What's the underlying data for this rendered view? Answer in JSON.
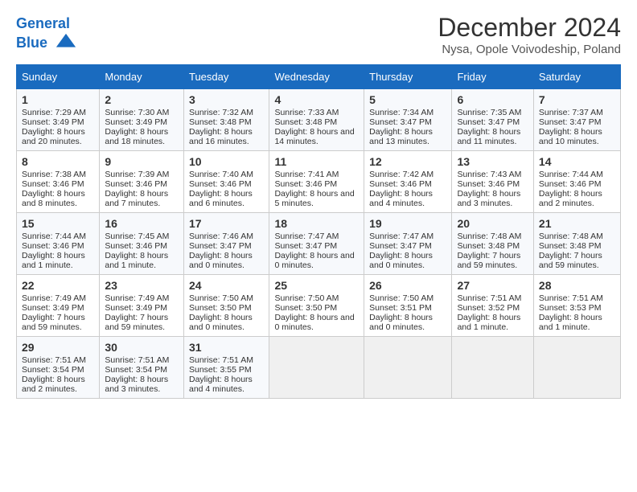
{
  "logo": {
    "line1": "General",
    "line2": "Blue"
  },
  "title": "December 2024",
  "subtitle": "Nysa, Opole Voivodeship, Poland",
  "headers": [
    "Sunday",
    "Monday",
    "Tuesday",
    "Wednesday",
    "Thursday",
    "Friday",
    "Saturday"
  ],
  "weeks": [
    [
      {
        "day": "1",
        "sunrise": "Sunrise: 7:29 AM",
        "sunset": "Sunset: 3:49 PM",
        "daylight": "Daylight: 8 hours and 20 minutes."
      },
      {
        "day": "2",
        "sunrise": "Sunrise: 7:30 AM",
        "sunset": "Sunset: 3:49 PM",
        "daylight": "Daylight: 8 hours and 18 minutes."
      },
      {
        "day": "3",
        "sunrise": "Sunrise: 7:32 AM",
        "sunset": "Sunset: 3:48 PM",
        "daylight": "Daylight: 8 hours and 16 minutes."
      },
      {
        "day": "4",
        "sunrise": "Sunrise: 7:33 AM",
        "sunset": "Sunset: 3:48 PM",
        "daylight": "Daylight: 8 hours and 14 minutes."
      },
      {
        "day": "5",
        "sunrise": "Sunrise: 7:34 AM",
        "sunset": "Sunset: 3:47 PM",
        "daylight": "Daylight: 8 hours and 13 minutes."
      },
      {
        "day": "6",
        "sunrise": "Sunrise: 7:35 AM",
        "sunset": "Sunset: 3:47 PM",
        "daylight": "Daylight: 8 hours and 11 minutes."
      },
      {
        "day": "7",
        "sunrise": "Sunrise: 7:37 AM",
        "sunset": "Sunset: 3:47 PM",
        "daylight": "Daylight: 8 hours and 10 minutes."
      }
    ],
    [
      {
        "day": "8",
        "sunrise": "Sunrise: 7:38 AM",
        "sunset": "Sunset: 3:46 PM",
        "daylight": "Daylight: 8 hours and 8 minutes."
      },
      {
        "day": "9",
        "sunrise": "Sunrise: 7:39 AM",
        "sunset": "Sunset: 3:46 PM",
        "daylight": "Daylight: 8 hours and 7 minutes."
      },
      {
        "day": "10",
        "sunrise": "Sunrise: 7:40 AM",
        "sunset": "Sunset: 3:46 PM",
        "daylight": "Daylight: 8 hours and 6 minutes."
      },
      {
        "day": "11",
        "sunrise": "Sunrise: 7:41 AM",
        "sunset": "Sunset: 3:46 PM",
        "daylight": "Daylight: 8 hours and 5 minutes."
      },
      {
        "day": "12",
        "sunrise": "Sunrise: 7:42 AM",
        "sunset": "Sunset: 3:46 PM",
        "daylight": "Daylight: 8 hours and 4 minutes."
      },
      {
        "day": "13",
        "sunrise": "Sunrise: 7:43 AM",
        "sunset": "Sunset: 3:46 PM",
        "daylight": "Daylight: 8 hours and 3 minutes."
      },
      {
        "day": "14",
        "sunrise": "Sunrise: 7:44 AM",
        "sunset": "Sunset: 3:46 PM",
        "daylight": "Daylight: 8 hours and 2 minutes."
      }
    ],
    [
      {
        "day": "15",
        "sunrise": "Sunrise: 7:44 AM",
        "sunset": "Sunset: 3:46 PM",
        "daylight": "Daylight: 8 hours and 1 minute."
      },
      {
        "day": "16",
        "sunrise": "Sunrise: 7:45 AM",
        "sunset": "Sunset: 3:46 PM",
        "daylight": "Daylight: 8 hours and 1 minute."
      },
      {
        "day": "17",
        "sunrise": "Sunrise: 7:46 AM",
        "sunset": "Sunset: 3:47 PM",
        "daylight": "Daylight: 8 hours and 0 minutes."
      },
      {
        "day": "18",
        "sunrise": "Sunrise: 7:47 AM",
        "sunset": "Sunset: 3:47 PM",
        "daylight": "Daylight: 8 hours and 0 minutes."
      },
      {
        "day": "19",
        "sunrise": "Sunrise: 7:47 AM",
        "sunset": "Sunset: 3:47 PM",
        "daylight": "Daylight: 8 hours and 0 minutes."
      },
      {
        "day": "20",
        "sunrise": "Sunrise: 7:48 AM",
        "sunset": "Sunset: 3:48 PM",
        "daylight": "Daylight: 7 hours and 59 minutes."
      },
      {
        "day": "21",
        "sunrise": "Sunrise: 7:48 AM",
        "sunset": "Sunset: 3:48 PM",
        "daylight": "Daylight: 7 hours and 59 minutes."
      }
    ],
    [
      {
        "day": "22",
        "sunrise": "Sunrise: 7:49 AM",
        "sunset": "Sunset: 3:49 PM",
        "daylight": "Daylight: 7 hours and 59 minutes."
      },
      {
        "day": "23",
        "sunrise": "Sunrise: 7:49 AM",
        "sunset": "Sunset: 3:49 PM",
        "daylight": "Daylight: 7 hours and 59 minutes."
      },
      {
        "day": "24",
        "sunrise": "Sunrise: 7:50 AM",
        "sunset": "Sunset: 3:50 PM",
        "daylight": "Daylight: 8 hours and 0 minutes."
      },
      {
        "day": "25",
        "sunrise": "Sunrise: 7:50 AM",
        "sunset": "Sunset: 3:50 PM",
        "daylight": "Daylight: 8 hours and 0 minutes."
      },
      {
        "day": "26",
        "sunrise": "Sunrise: 7:50 AM",
        "sunset": "Sunset: 3:51 PM",
        "daylight": "Daylight: 8 hours and 0 minutes."
      },
      {
        "day": "27",
        "sunrise": "Sunrise: 7:51 AM",
        "sunset": "Sunset: 3:52 PM",
        "daylight": "Daylight: 8 hours and 1 minute."
      },
      {
        "day": "28",
        "sunrise": "Sunrise: 7:51 AM",
        "sunset": "Sunset: 3:53 PM",
        "daylight": "Daylight: 8 hours and 1 minute."
      }
    ],
    [
      {
        "day": "29",
        "sunrise": "Sunrise: 7:51 AM",
        "sunset": "Sunset: 3:54 PM",
        "daylight": "Daylight: 8 hours and 2 minutes."
      },
      {
        "day": "30",
        "sunrise": "Sunrise: 7:51 AM",
        "sunset": "Sunset: 3:54 PM",
        "daylight": "Daylight: 8 hours and 3 minutes."
      },
      {
        "day": "31",
        "sunrise": "Sunrise: 7:51 AM",
        "sunset": "Sunset: 3:55 PM",
        "daylight": "Daylight: 8 hours and 4 minutes."
      },
      null,
      null,
      null,
      null
    ]
  ]
}
